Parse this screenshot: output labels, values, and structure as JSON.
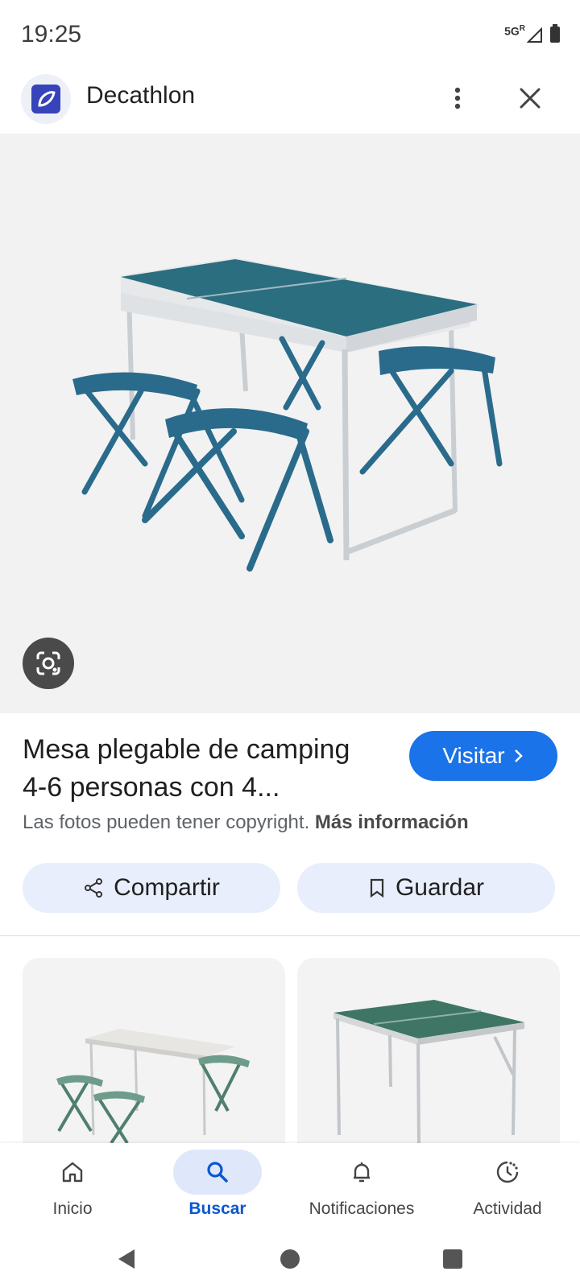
{
  "status_bar": {
    "time": "19:25",
    "network": "5G",
    "roaming": "R"
  },
  "header": {
    "site_name": "Decathlon",
    "logo_icon": "decathlon-logo",
    "more_icon": "more-vert-icon",
    "close_icon": "close-icon"
  },
  "result": {
    "title_line1": "Mesa plegable de camping",
    "title_line2": "4-6 personas con 4...",
    "visit_label": "Visitar",
    "copyright_text": "Las fotos pueden tener copyright.",
    "more_info_label": "Más información"
  },
  "actions": {
    "share_label": "Compartir",
    "save_label": "Guardar"
  },
  "bottom_nav": {
    "items": [
      {
        "label": "Inicio",
        "icon": "home-icon"
      },
      {
        "label": "Buscar",
        "icon": "search-icon",
        "active": true
      },
      {
        "label": "Notificaciones",
        "icon": "bell-icon"
      },
      {
        "label": "Actividad",
        "icon": "activity-icon"
      }
    ]
  },
  "colors": {
    "accent": "#1a73e8",
    "chip_bg": "#e8eefb",
    "table_teal": "#2a6e80",
    "stool_blue": "#2a6b8c",
    "stool_green": "#6d9c8a"
  }
}
